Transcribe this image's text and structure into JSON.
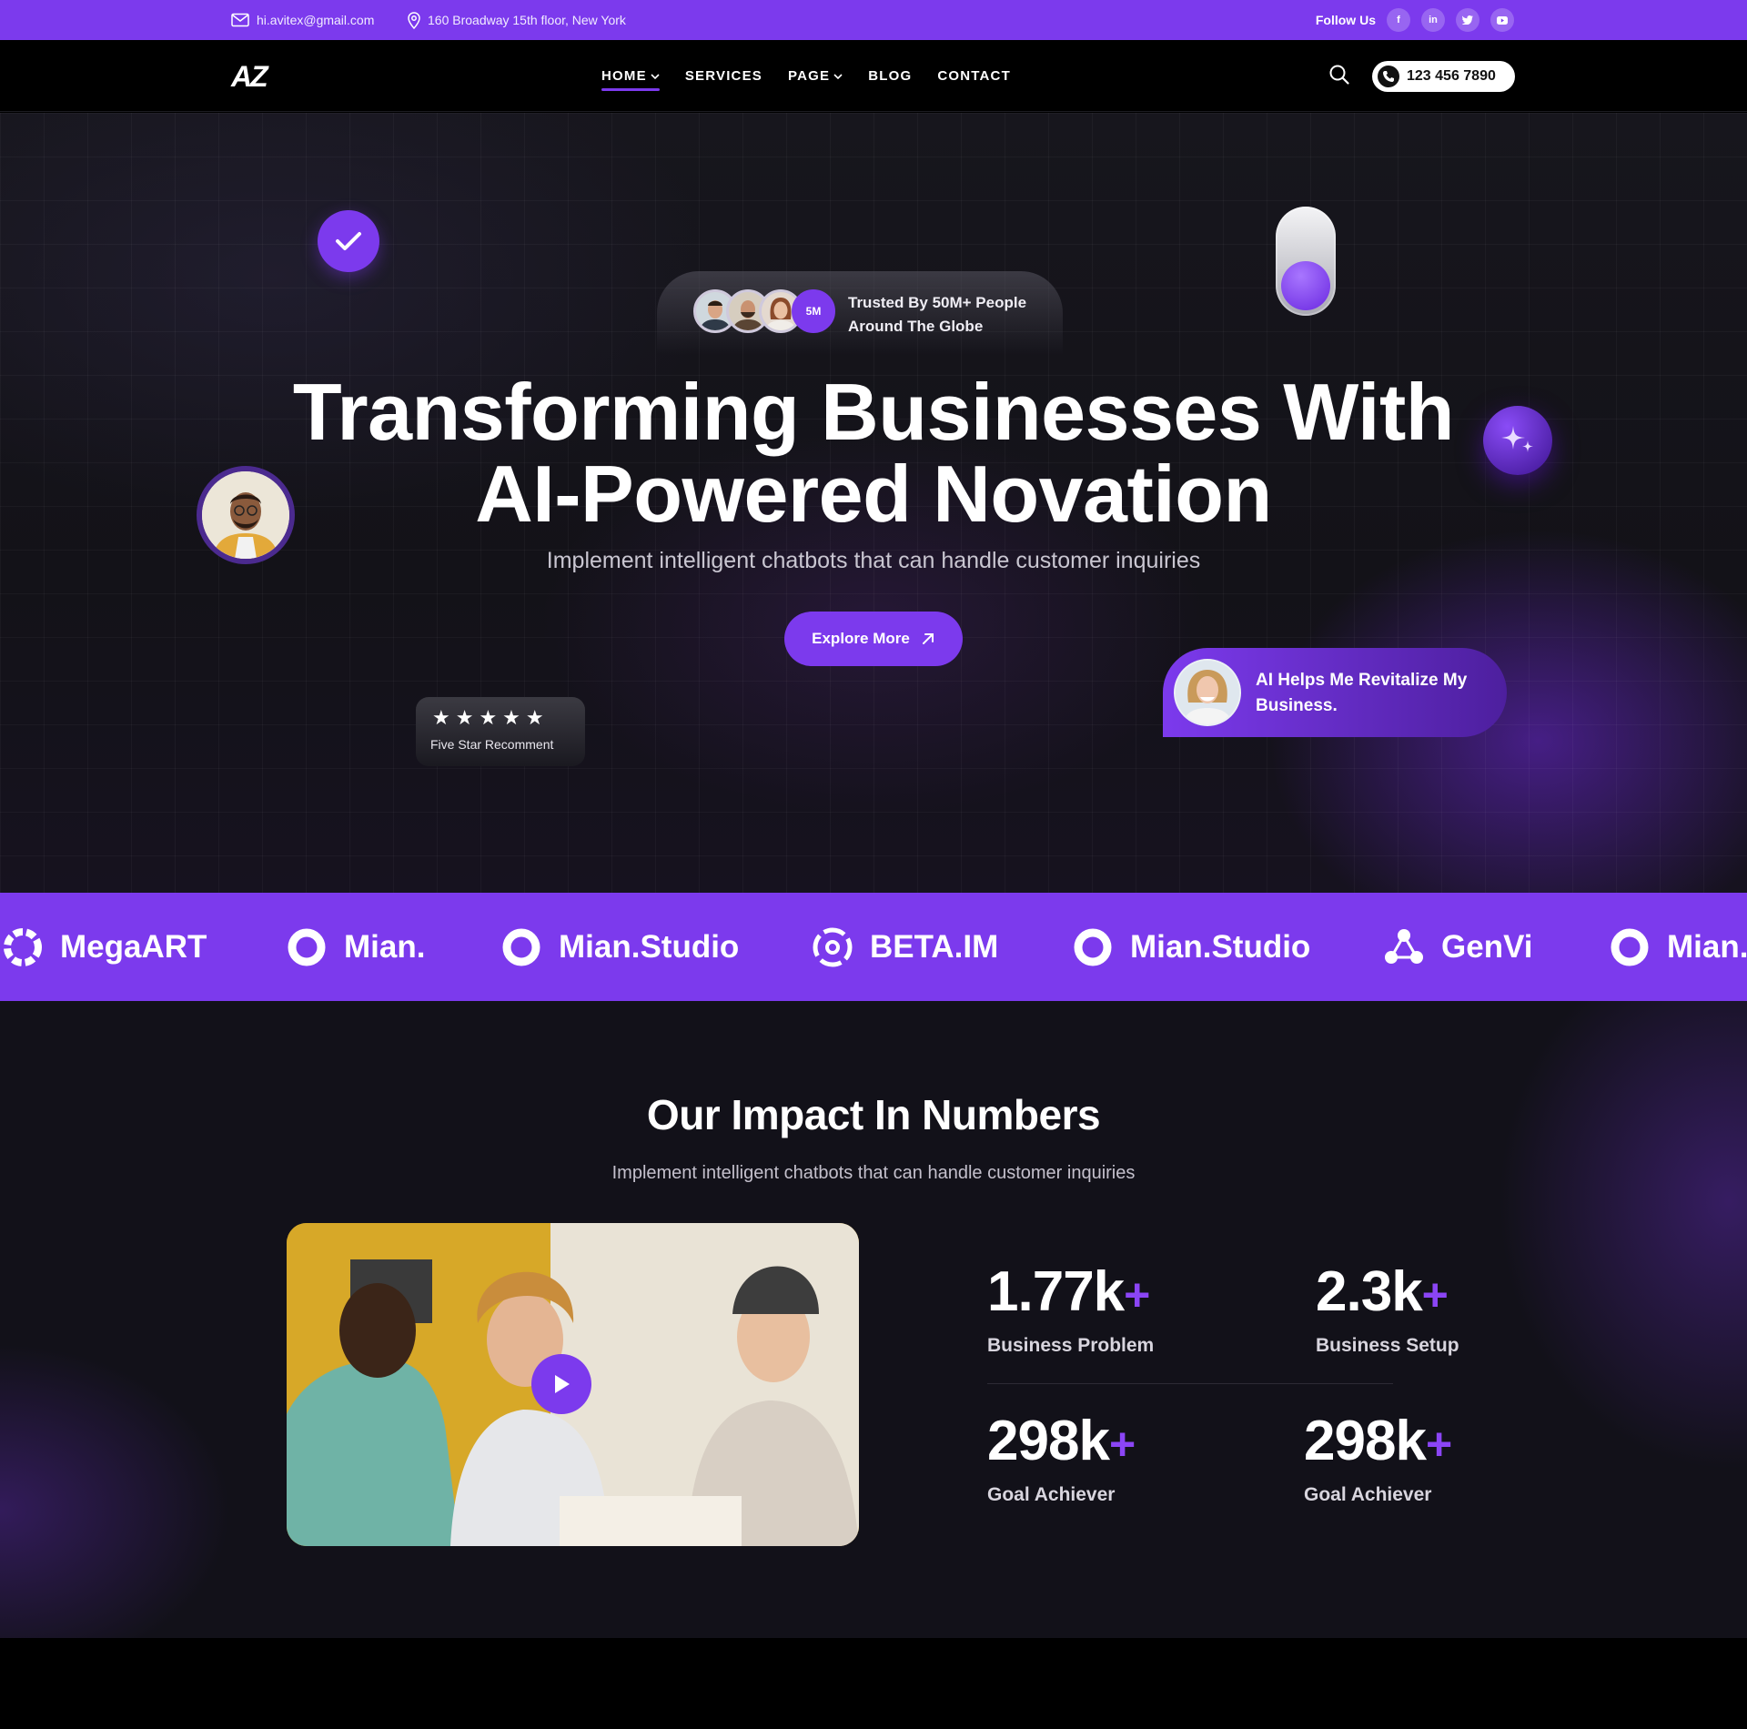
{
  "topbar": {
    "email": "hi.avitex@gmail.com",
    "address": "160 Broadway 15th floor, New York",
    "follow_label": "Follow Us",
    "socials": [
      {
        "name": "facebook",
        "glyph": "f"
      },
      {
        "name": "linkedin",
        "glyph": "in"
      },
      {
        "name": "twitter",
        "glyph": "t"
      },
      {
        "name": "youtube",
        "glyph": "▶"
      }
    ]
  },
  "nav": {
    "logo": "AZ",
    "items": [
      {
        "label": "HOME",
        "active": true,
        "dropdown": true
      },
      {
        "label": "SERVICES",
        "active": false,
        "dropdown": false
      },
      {
        "label": "PAGE",
        "active": false,
        "dropdown": true
      },
      {
        "label": "BLOG",
        "active": false,
        "dropdown": false
      },
      {
        "label": "CONTACT",
        "active": false,
        "dropdown": false
      }
    ],
    "phone": "123 456 7890"
  },
  "hero": {
    "trusted_count": "5M",
    "trusted_text": "Trusted By 50M+ People Around The Globe",
    "title_line1": "Transforming Businesses With",
    "title_line2": "AI-Powered Novation",
    "subtitle": "Implement intelligent chatbots that can handle customer inquiries",
    "cta": "Explore More",
    "stars_label": "Five Star Recomment",
    "stars_glyphs": "★★★★★",
    "testimonial": "AI Helps Me Revitalize My Business."
  },
  "brands": [
    {
      "name": "MegaART",
      "icon": "ring-icon"
    },
    {
      "name": "Mian.",
      "icon": "swirl-icon"
    },
    {
      "name": "Mian.Studio",
      "icon": "swirl-icon"
    },
    {
      "name": "BETA.IM",
      "icon": "spiral-icon"
    },
    {
      "name": "Mian.Studio",
      "icon": "swirl-icon"
    },
    {
      "name": "GenVi",
      "icon": "nodes-icon"
    },
    {
      "name": "Mian.",
      "icon": "swirl-icon"
    }
  ],
  "impact": {
    "title": "Our Impact In Numbers",
    "subtitle": "Implement intelligent chatbots that can handle customer inquiries",
    "stats": [
      {
        "value": "1.77k",
        "plus": "+",
        "label": "Business Problem"
      },
      {
        "value": "2.3k",
        "plus": "+",
        "label": "Business Setup"
      },
      {
        "value": "298k",
        "plus": "+",
        "label": "Goal Achiever"
      },
      {
        "value": "298k",
        "plus": "+",
        "label": "Goal Achiever"
      }
    ]
  },
  "colors": {
    "accent": "#7c3aed",
    "background": "#121119"
  }
}
